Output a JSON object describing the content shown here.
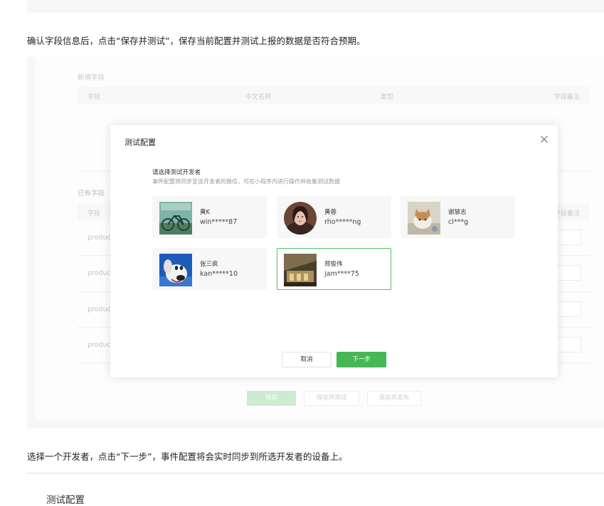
{
  "intro_text": "确认字段信息后，点击“保存并测试”，保存当前配置并测试上报的数据是否符合预期。",
  "screenshot": {
    "new_fields_label": "新增字段",
    "table_headers": [
      "字段",
      "中文名称",
      "类型",
      "字段备注"
    ],
    "existing_fields_label": "已有字段",
    "existing_header_left": "字段",
    "existing_header_right": "字段备注",
    "row_prefix": "product",
    "buttons": {
      "save": "保存",
      "save_test": "保存并测试",
      "save_publish": "保存并发布"
    }
  },
  "modal": {
    "title": "测试配置",
    "prompt_title": "请选择测试开发者",
    "prompt_desc": "事件配置将同步至该开发者的微信，可在小程序内进行操作并收集测试数据",
    "developers": [
      {
        "name": "黄K",
        "id": "win*****87",
        "avatar": "bicycle-avatar",
        "selected": false
      },
      {
        "name": "黄蓉",
        "id": "rho*****ng",
        "avatar": "portrait-avatar",
        "selected": false
      },
      {
        "name": "谢慧志",
        "id": "cl***g",
        "avatar": "kitten-avatar",
        "selected": false
      },
      {
        "name": "张三疯",
        "id": "kan*****10",
        "avatar": "cartoon-dog-avatar",
        "selected": false
      },
      {
        "name": "郑俊伟",
        "id": "jam****75",
        "avatar": "street-avatar",
        "selected": true
      }
    ],
    "cancel_label": "取消",
    "next_label": "下一步"
  },
  "second_text": "选择一个开发者，点击“下一步”，事件配置将会实时同步到所选开发者的设备上。",
  "bottom_title": "测试配置",
  "colors": {
    "accent_green": "#46b755",
    "selected_border": "#53c15f"
  }
}
